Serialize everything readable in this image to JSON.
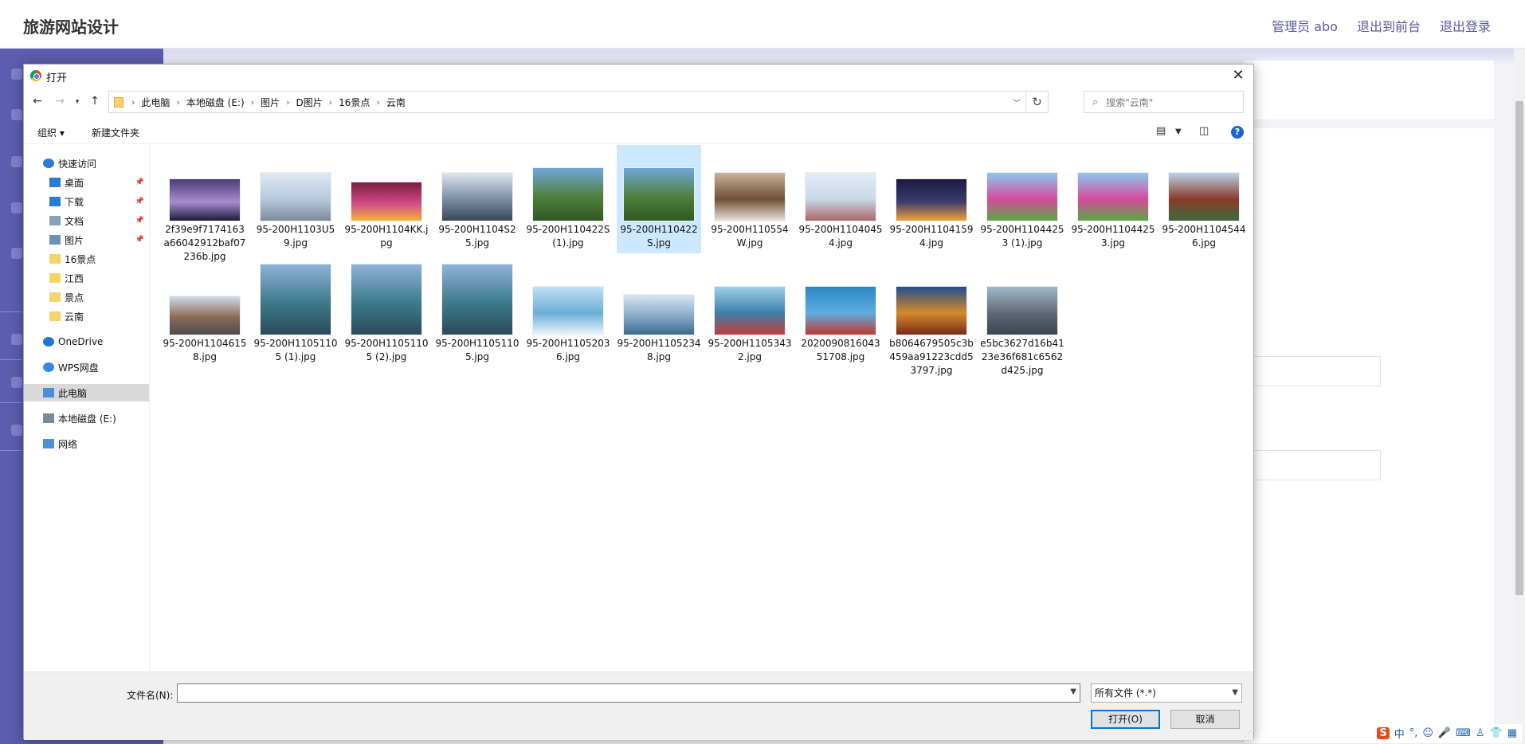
{
  "site": {
    "title": "旅游网站设计",
    "links": [
      "管理员 abo",
      "退出到前台",
      "退出登录"
    ]
  },
  "ime": {
    "items": [
      "S",
      "中",
      "°,",
      "☺",
      "🎤",
      "⌨",
      "♙",
      "👕",
      "▦"
    ]
  },
  "dialog": {
    "title": "打开",
    "close_glyph": "✕",
    "breadcrumb": [
      "此电脑",
      "本地磁盘 (E:)",
      "图片",
      "D图片",
      "16景点",
      "云南"
    ],
    "search_placeholder": "搜索\"云南\"",
    "organize_label": "组织 ▾",
    "new_folder_label": "新建文件夹",
    "help_glyph": "?",
    "nav": [
      {
        "label": "快速访问",
        "icon": "star-icon",
        "color": "#2b7bd5"
      },
      {
        "label": "桌面",
        "icon": "desktop-icon",
        "color": "#2b7bd5",
        "pinned": true
      },
      {
        "label": "下载",
        "icon": "download-icon",
        "color": "#2b7bd5",
        "pinned": true
      },
      {
        "label": "文档",
        "icon": "document-icon",
        "color": "#8aa0b8",
        "pinned": true
      },
      {
        "label": "图片",
        "icon": "pictures-icon",
        "color": "#6a8fb8",
        "pinned": true
      },
      {
        "label": "16景点",
        "icon": "folder-icon",
        "color": "#f6d36b"
      },
      {
        "label": "江西",
        "icon": "folder-icon",
        "color": "#f6d36b"
      },
      {
        "label": "景点",
        "icon": "folder-icon",
        "color": "#f6d36b"
      },
      {
        "label": "云南",
        "icon": "folder-icon",
        "color": "#f6d36b"
      },
      {
        "label": "OneDrive",
        "icon": "cloud-icon",
        "color": "#1b78d6"
      },
      {
        "label": "WPS网盘",
        "icon": "cloud-icon",
        "color": "#3a86e8"
      },
      {
        "label": "此电脑",
        "icon": "computer-icon",
        "color": "#4a90d9",
        "selected": true
      },
      {
        "label": "本地磁盘 (E:)",
        "icon": "drive-icon",
        "color": "#7a8a99"
      },
      {
        "label": "网络",
        "icon": "network-icon",
        "color": "#4a90d9"
      }
    ],
    "files": [
      {
        "name": "2f39e9f7174163a66042912baf07236b.jpg",
        "colors": [
          "#4b3c7a",
          "#a78ccf",
          "#1c1c3a"
        ]
      },
      {
        "name": "95-200H1103U59.jpg",
        "colors": [
          "#dfe9f3",
          "#b5c9dc",
          "#7d8a99"
        ]
      },
      {
        "name": "95-200H1104KK.jpg",
        "colors": [
          "#7a1d3e",
          "#d24b8a",
          "#f2b23b"
        ]
      },
      {
        "name": "95-200H1104S25.jpg",
        "colors": [
          "#dde6ee",
          "#7a8ea4",
          "#3b4657"
        ]
      },
      {
        "name": "95-200H110422S (1).jpg",
        "colors": [
          "#6fa8dc",
          "#4f7f3a",
          "#2f5a24"
        ]
      },
      {
        "name": "95-200H110422S.jpg",
        "colors": [
          "#6fa8dc",
          "#4f7f3a",
          "#2f5a24"
        ],
        "selected": true
      },
      {
        "name": "95-200H110554W.jpg",
        "colors": [
          "#c9b39a",
          "#6e4e37",
          "#e8e1d6"
        ]
      },
      {
        "name": "95-200H11040454.jpg",
        "colors": [
          "#e4edf5",
          "#c8d9ea",
          "#a66"
        ]
      },
      {
        "name": "95-200H11041594.jpg",
        "colors": [
          "#1a1a40",
          "#3c3c6e",
          "#f2a13b"
        ]
      },
      {
        "name": "95-200H11044253 (1).jpg",
        "colors": [
          "#8cc7ee",
          "#d64b9b",
          "#5aa845"
        ]
      },
      {
        "name": "95-200H11044253.jpg",
        "colors": [
          "#8cc7ee",
          "#d64b9b",
          "#5aa845"
        ]
      },
      {
        "name": "95-200H11045446.jpg",
        "colors": [
          "#b8d4ec",
          "#8a3a2a",
          "#3f6a3a"
        ]
      },
      {
        "name": "95-200H11046158.jpg",
        "colors": [
          "#cfdceb",
          "#8b6a55",
          "#4d4d4d"
        ]
      },
      {
        "name": "95-200H11051105 (1).jpg",
        "colors": [
          "#8fb3d9",
          "#3c7a8a",
          "#2a4a5a"
        ]
      },
      {
        "name": "95-200H11051105 (2).jpg",
        "colors": [
          "#8fb3d9",
          "#3c7a8a",
          "#2a4a5a"
        ]
      },
      {
        "name": "95-200H11051105.jpg",
        "colors": [
          "#8fb3d9",
          "#3c7a8a",
          "#2a4a5a"
        ]
      },
      {
        "name": "95-200H11052036.jpg",
        "colors": [
          "#bfe1f4",
          "#6aaed6",
          "#e9f4fb"
        ]
      },
      {
        "name": "95-200H11052348.jpg",
        "colors": [
          "#d8e6f2",
          "#86a8c8",
          "#3c6a90"
        ]
      },
      {
        "name": "95-200H11053432.jpg",
        "colors": [
          "#9fd0ea",
          "#3b7fa8",
          "#c23b3b"
        ]
      },
      {
        "name": "2020090816043 51708.jpg",
        "colors": [
          "#2e86c1",
          "#5dade2",
          "#c0392b"
        ]
      },
      {
        "name": "b8064679505c3b459aa91223cdd53797.jpg",
        "colors": [
          "#1f4f8f",
          "#d68a2a",
          "#7a2a1a"
        ]
      },
      {
        "name": "e5bc3627d16b4123e36f681c6562d425.jpg",
        "colors": [
          "#9fb8cf",
          "#606a75",
          "#3a4450"
        ]
      }
    ],
    "footer": {
      "filename_label": "文件名(N):",
      "filename_value": "",
      "filetype": "所有文件 (*.*)",
      "open_label": "打开(O)",
      "cancel_label": "取消"
    }
  }
}
